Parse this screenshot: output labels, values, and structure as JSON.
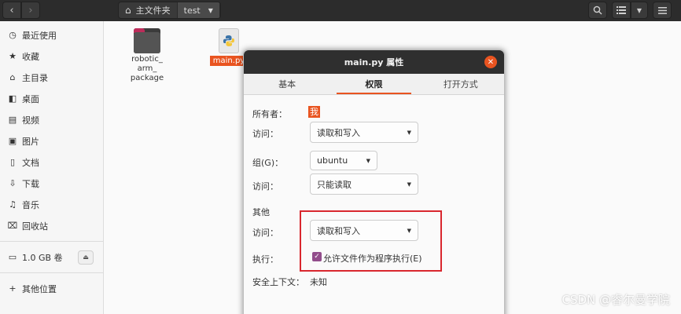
{
  "header": {
    "path": [
      "主文件夹",
      "test"
    ]
  },
  "sidebar": {
    "items": [
      {
        "label": "最近使用",
        "icon": "clock-icon"
      },
      {
        "label": "收藏",
        "icon": "star-icon"
      },
      {
        "label": "主目录",
        "icon": "home-icon"
      },
      {
        "label": "桌面",
        "icon": "desktop-icon"
      },
      {
        "label": "视频",
        "icon": "video-icon"
      },
      {
        "label": "图片",
        "icon": "picture-icon"
      },
      {
        "label": "文档",
        "icon": "document-icon"
      },
      {
        "label": "下载",
        "icon": "download-icon"
      },
      {
        "label": "音乐",
        "icon": "music-icon"
      },
      {
        "label": "回收站",
        "icon": "trash-icon"
      }
    ],
    "volume": {
      "label": "1.0 GB 卷",
      "icon": "drive-icon"
    },
    "other": {
      "label": "其他位置",
      "icon": "plus-icon"
    }
  },
  "files": {
    "folder": {
      "name_lines": [
        "robotic_",
        "arm_",
        "package"
      ]
    },
    "pyfile": {
      "name": "main.py"
    }
  },
  "dialog": {
    "title": "main.py 属性",
    "tabs": [
      "基本",
      "权限",
      "打开方式"
    ],
    "active_tab": "权限",
    "owner_label": "所有者：",
    "owner_value": "我",
    "access_label": "访问：",
    "owner_access": "读取和写入",
    "group_label": "组(G)：",
    "group_value": "ubuntu",
    "group_access": "只能读取",
    "others_label": "其他",
    "others_access": "读取和写入",
    "execute_label": "执行：",
    "execute_checkbox": "允许文件作为程序执行(E)",
    "execute_checked": true,
    "security_label": "安全上下文：",
    "security_value": "未知"
  },
  "watermark": "CSDN @睿尔曼学院",
  "colors": {
    "accent": "#e95420",
    "checkbox": "#924d8b",
    "highlight_box": "#d9272e",
    "headerbar": "#2c2c2c"
  }
}
